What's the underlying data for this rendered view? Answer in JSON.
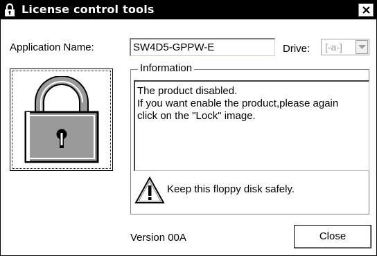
{
  "window": {
    "title": "License control tools"
  },
  "app": {
    "name_label": "Application Name:",
    "name_value": "SW4D5-GPPW-E",
    "drive_label": "Drive:",
    "drive_value": "[-a-]"
  },
  "info": {
    "group_label": "Information",
    "lines": [
      "The product disabled.",
      "If you want enable the product,please again",
      "click on the \"Lock\" image."
    ]
  },
  "warning": {
    "text": "Keep this floppy disk safely."
  },
  "footer": {
    "version": "Version 00A",
    "close_label": "Close"
  },
  "icons": {
    "title_icon": "padlock-icon",
    "close": "close-icon",
    "drive_arrow": "chevron-down-icon",
    "lock_image": "padlock-icon",
    "warning": "warning-icon"
  },
  "colors": {
    "titlebar": "#000000",
    "lock_body": "#9a9a9a"
  }
}
